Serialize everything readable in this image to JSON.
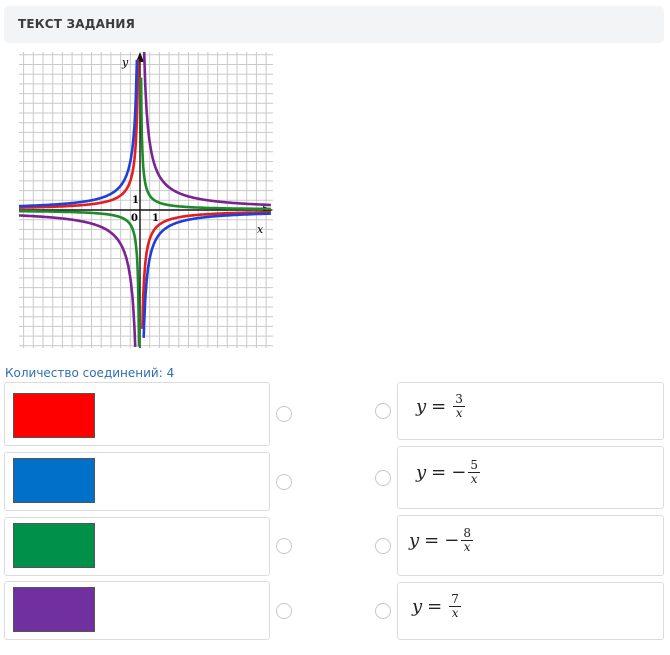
{
  "header": {
    "title": "ТЕКСТ ЗАДАНИЯ"
  },
  "graph": {
    "axis_x_label": "x",
    "axis_y_label": "y",
    "origin_label": "0",
    "unit_x_label": "1",
    "unit_y_label": "1",
    "curves": [
      {
        "color": "#e31e1e",
        "k": -3
      },
      {
        "color": "#1f3fd9",
        "k": -5
      },
      {
        "color": "#1e8a2a",
        "k": 1.5
      },
      {
        "color": "#7b2392",
        "k": 7
      }
    ]
  },
  "connections": {
    "label": "Количество соединений: 4"
  },
  "left_items": [
    {
      "color": "#ff0000"
    },
    {
      "color": "#0070c8"
    },
    {
      "color": "#00904a"
    },
    {
      "color": "#7030a0"
    }
  ],
  "right_items": [
    {
      "y": "y",
      "eq": "=",
      "sign": "",
      "num": "3",
      "den": "x"
    },
    {
      "y": "y",
      "eq": "=",
      "sign": "−",
      "num": "5",
      "den": "x"
    },
    {
      "y": "y",
      "eq": "=",
      "sign": "−",
      "num": "8",
      "den": "x"
    },
    {
      "y": "y",
      "eq": "=",
      "sign": "",
      "num": "7",
      "den": "x"
    }
  ]
}
